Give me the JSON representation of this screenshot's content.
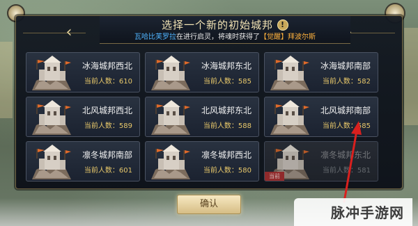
{
  "header": {
    "title": "选择一个新的初始城邦",
    "info_icon": "!",
    "subtitle_name": "瓦哈比芙罗拉",
    "subtitle_mid": "在进行启灵，将魂时获得了",
    "subtitle_reward": "【觉醒】拜波尔斯"
  },
  "cities": [
    {
      "name": "冰海城邦西北",
      "pop_label": "当前人数：",
      "pop": "610",
      "current": false,
      "disabled": false
    },
    {
      "name": "冰海城邦东北",
      "pop_label": "当前人数：",
      "pop": "585",
      "current": false,
      "disabled": false
    },
    {
      "name": "冰海城邦南部",
      "pop_label": "当前人数：",
      "pop": "582",
      "current": false,
      "disabled": false
    },
    {
      "name": "北风城邦西北",
      "pop_label": "当前人数：",
      "pop": "589",
      "current": false,
      "disabled": false
    },
    {
      "name": "北风城邦东北",
      "pop_label": "当前人数：",
      "pop": "588",
      "current": false,
      "disabled": false
    },
    {
      "name": "北风城邦南部",
      "pop_label": "当前人数：",
      "pop": "585",
      "current": false,
      "disabled": false
    },
    {
      "name": "凛冬城邦南部",
      "pop_label": "当前人数：",
      "pop": "601",
      "current": false,
      "disabled": false
    },
    {
      "name": "凛冬城邦西北",
      "pop_label": "当前人数：",
      "pop": "580",
      "current": false,
      "disabled": false
    },
    {
      "name": "凛冬城邦东北",
      "pop_label": "当前人数：",
      "pop": "581",
      "current": true,
      "disabled": true,
      "tag": "当前"
    }
  ],
  "confirm_label": "确认",
  "watermark": "脉冲手游网",
  "colors": {
    "accent_gold": "#e8c86a",
    "panel_bg": "#121821",
    "name_blue": "#4fb4ff",
    "reward_orange": "#ffb23d",
    "annotation_red": "#d9201e"
  }
}
